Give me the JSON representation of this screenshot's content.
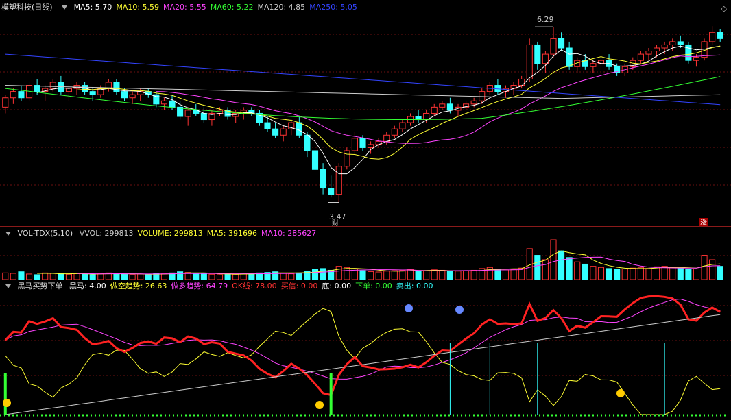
{
  "main": {
    "title": "模塑科技(日线)",
    "ma": [
      {
        "label": "MA5: 5.70",
        "color": "#ffffff"
      },
      {
        "label": "MA10: 5.59",
        "color": "#ffff33"
      },
      {
        "label": "MA20: 5.55",
        "color": "#ff44ff"
      },
      {
        "label": "MA60: 5.22",
        "color": "#33ff33"
      },
      {
        "label": "MA120: 4.85",
        "color": "#cccccc"
      },
      {
        "label": "MA250: 5.05",
        "color": "#3344ff"
      }
    ],
    "high_label": "6.29",
    "low_label": "3.47",
    "cai_label": "财",
    "zhang_label": "涨",
    "close_icon": "diamond-close-icon"
  },
  "volume": {
    "title": "VOL-TDX(5,10)",
    "items": [
      {
        "label": "VVOL: 299813",
        "color": "#cccccc"
      },
      {
        "label": "VOLUME: 299813",
        "color": "#ffff33"
      },
      {
        "label": "MA5: 391696",
        "color": "#ffff33"
      },
      {
        "label": "MA10: 285627",
        "color": "#ff44ff"
      }
    ]
  },
  "indicator": {
    "title": "黑马买势下单",
    "items": [
      {
        "label": "黑马: 4.00",
        "color": "#ffffff"
      },
      {
        "label": "做空趋势: 26.63",
        "color": "#ffff33"
      },
      {
        "label": "做多趋势: 64.79",
        "color": "#ff44ff"
      },
      {
        "label": "OK线: 78.00",
        "color": "#ff3333"
      },
      {
        "label": "买信: 0.00",
        "color": "#ff3333"
      },
      {
        "label": "底: 0.00",
        "color": "#ffffff"
      },
      {
        "label": "下单: 0.00",
        "color": "#33ff33"
      },
      {
        "label": "卖出: 0.00",
        "color": "#33ffff"
      }
    ]
  },
  "chart_data": {
    "type": "candlestick",
    "up_color": "#ff3333",
    "down_color": "#33ffff",
    "price_range": [
      3.2,
      6.5
    ],
    "candles": [
      [
        5.0,
        5.2,
        4.9,
        5.15
      ],
      [
        5.15,
        5.3,
        5.05,
        5.25
      ],
      [
        5.25,
        5.35,
        5.1,
        5.15
      ],
      [
        5.15,
        5.4,
        5.1,
        5.35
      ],
      [
        5.35,
        5.45,
        5.2,
        5.25
      ],
      [
        5.25,
        5.35,
        5.1,
        5.3
      ],
      [
        5.3,
        5.45,
        5.25,
        5.4
      ],
      [
        5.4,
        5.5,
        5.2,
        5.25
      ],
      [
        5.25,
        5.35,
        5.1,
        5.3
      ],
      [
        5.3,
        5.4,
        5.2,
        5.35
      ],
      [
        5.35,
        5.4,
        5.2,
        5.25
      ],
      [
        5.25,
        5.3,
        5.1,
        5.2
      ],
      [
        5.2,
        5.35,
        5.15,
        5.3
      ],
      [
        5.3,
        5.45,
        5.25,
        5.4
      ],
      [
        5.4,
        5.45,
        5.2,
        5.25
      ],
      [
        5.25,
        5.3,
        5.1,
        5.15
      ],
      [
        5.15,
        5.25,
        5.05,
        5.2
      ],
      [
        5.2,
        5.3,
        5.1,
        5.25
      ],
      [
        5.25,
        5.3,
        5.15,
        5.2
      ],
      [
        5.2,
        5.25,
        5.0,
        5.05
      ],
      [
        5.05,
        5.15,
        4.95,
        5.1
      ],
      [
        5.1,
        5.2,
        4.95,
        5.0
      ],
      [
        5.0,
        5.1,
        4.8,
        4.85
      ],
      [
        4.85,
        5.0,
        4.7,
        4.95
      ],
      [
        4.95,
        5.05,
        4.85,
        4.9
      ],
      [
        4.9,
        5.0,
        4.75,
        4.8
      ],
      [
        4.8,
        4.95,
        4.7,
        4.9
      ],
      [
        4.9,
        5.0,
        4.85,
        4.95
      ],
      [
        4.95,
        5.0,
        4.8,
        4.85
      ],
      [
        4.85,
        4.95,
        4.75,
        4.9
      ],
      [
        4.9,
        5.0,
        4.8,
        4.95
      ],
      [
        4.95,
        5.0,
        4.85,
        4.9
      ],
      [
        4.9,
        4.95,
        4.7,
        4.75
      ],
      [
        4.75,
        4.85,
        4.6,
        4.65
      ],
      [
        4.65,
        4.75,
        4.5,
        4.55
      ],
      [
        4.55,
        4.7,
        4.45,
        4.65
      ],
      [
        4.65,
        4.8,
        4.55,
        4.75
      ],
      [
        4.75,
        4.85,
        4.5,
        4.55
      ],
      [
        4.55,
        4.6,
        4.2,
        4.3
      ],
      [
        4.3,
        4.4,
        3.9,
        4.0
      ],
      [
        4.0,
        4.1,
        3.6,
        3.7
      ],
      [
        3.7,
        3.9,
        3.55,
        3.6
      ],
      [
        3.6,
        4.1,
        3.47,
        4.05
      ],
      [
        4.05,
        4.35,
        4.0,
        4.3
      ],
      [
        4.3,
        4.6,
        4.25,
        4.5
      ],
      [
        4.5,
        4.55,
        4.3,
        4.35
      ],
      [
        4.35,
        4.45,
        4.25,
        4.4
      ],
      [
        4.4,
        4.5,
        4.35,
        4.45
      ],
      [
        4.45,
        4.6,
        4.4,
        4.55
      ],
      [
        4.55,
        4.7,
        4.5,
        4.65
      ],
      [
        4.65,
        4.8,
        4.6,
        4.75
      ],
      [
        4.75,
        4.9,
        4.7,
        4.85
      ],
      [
        4.85,
        4.95,
        4.75,
        4.8
      ],
      [
        4.8,
        4.95,
        4.75,
        4.9
      ],
      [
        4.9,
        5.05,
        4.85,
        5.0
      ],
      [
        5.0,
        5.1,
        4.95,
        5.05
      ],
      [
        5.05,
        5.15,
        4.9,
        4.95
      ],
      [
        4.95,
        5.05,
        4.85,
        5.0
      ],
      [
        5.0,
        5.1,
        4.95,
        5.05
      ],
      [
        5.05,
        5.15,
        5.0,
        5.1
      ],
      [
        5.1,
        5.3,
        5.05,
        5.25
      ],
      [
        5.25,
        5.4,
        5.2,
        5.35
      ],
      [
        5.35,
        5.45,
        5.2,
        5.25
      ],
      [
        5.25,
        5.35,
        5.15,
        5.3
      ],
      [
        5.3,
        5.4,
        5.2,
        5.35
      ],
      [
        5.35,
        5.5,
        5.3,
        5.45
      ],
      [
        5.45,
        6.1,
        5.4,
        6.0
      ],
      [
        6.0,
        6.05,
        5.6,
        5.7
      ],
      [
        5.7,
        5.9,
        5.55,
        5.85
      ],
      [
        5.85,
        6.29,
        5.8,
        6.1
      ],
      [
        6.1,
        6.2,
        5.9,
        5.95
      ],
      [
        5.95,
        6.05,
        5.6,
        5.65
      ],
      [
        5.65,
        5.8,
        5.55,
        5.75
      ],
      [
        5.75,
        5.85,
        5.6,
        5.65
      ],
      [
        5.65,
        5.75,
        5.55,
        5.7
      ],
      [
        5.7,
        5.8,
        5.6,
        5.75
      ],
      [
        5.75,
        5.85,
        5.6,
        5.65
      ],
      [
        5.65,
        5.7,
        5.5,
        5.55
      ],
      [
        5.55,
        5.7,
        5.5,
        5.65
      ],
      [
        5.65,
        5.8,
        5.6,
        5.75
      ],
      [
        5.75,
        5.9,
        5.7,
        5.85
      ],
      [
        5.85,
        5.95,
        5.75,
        5.9
      ],
      [
        5.9,
        6.0,
        5.8,
        5.95
      ],
      [
        5.95,
        6.05,
        5.85,
        6.0
      ],
      [
        6.0,
        6.1,
        5.9,
        6.05
      ],
      [
        6.05,
        6.15,
        5.95,
        6.0
      ],
      [
        6.0,
        6.05,
        5.7,
        5.75
      ],
      [
        5.75,
        5.85,
        5.65,
        5.8
      ],
      [
        5.8,
        6.1,
        5.75,
        6.05
      ],
      [
        6.05,
        6.3,
        6.0,
        6.2
      ],
      [
        6.2,
        6.25,
        6.05,
        6.1
      ]
    ],
    "volume": [
      30,
      28,
      35,
      25,
      22,
      30,
      28,
      26,
      24,
      27,
      25,
      22,
      28,
      30,
      26,
      24,
      22,
      25,
      23,
      28,
      26,
      30,
      35,
      32,
      28,
      25,
      24,
      22,
      26,
      24,
      28,
      25,
      30,
      32,
      35,
      28,
      26,
      30,
      38,
      45,
      50,
      42,
      60,
      55,
      48,
      40,
      36,
      34,
      38,
      40,
      42,
      45,
      38,
      40,
      44,
      42,
      36,
      38,
      40,
      42,
      50,
      55,
      48,
      44,
      46,
      52,
      140,
      110,
      90,
      180,
      130,
      100,
      80,
      70,
      60,
      55,
      50,
      45,
      48,
      52,
      55,
      50,
      58,
      60,
      56,
      50,
      45,
      48,
      110,
      90,
      60
    ]
  }
}
